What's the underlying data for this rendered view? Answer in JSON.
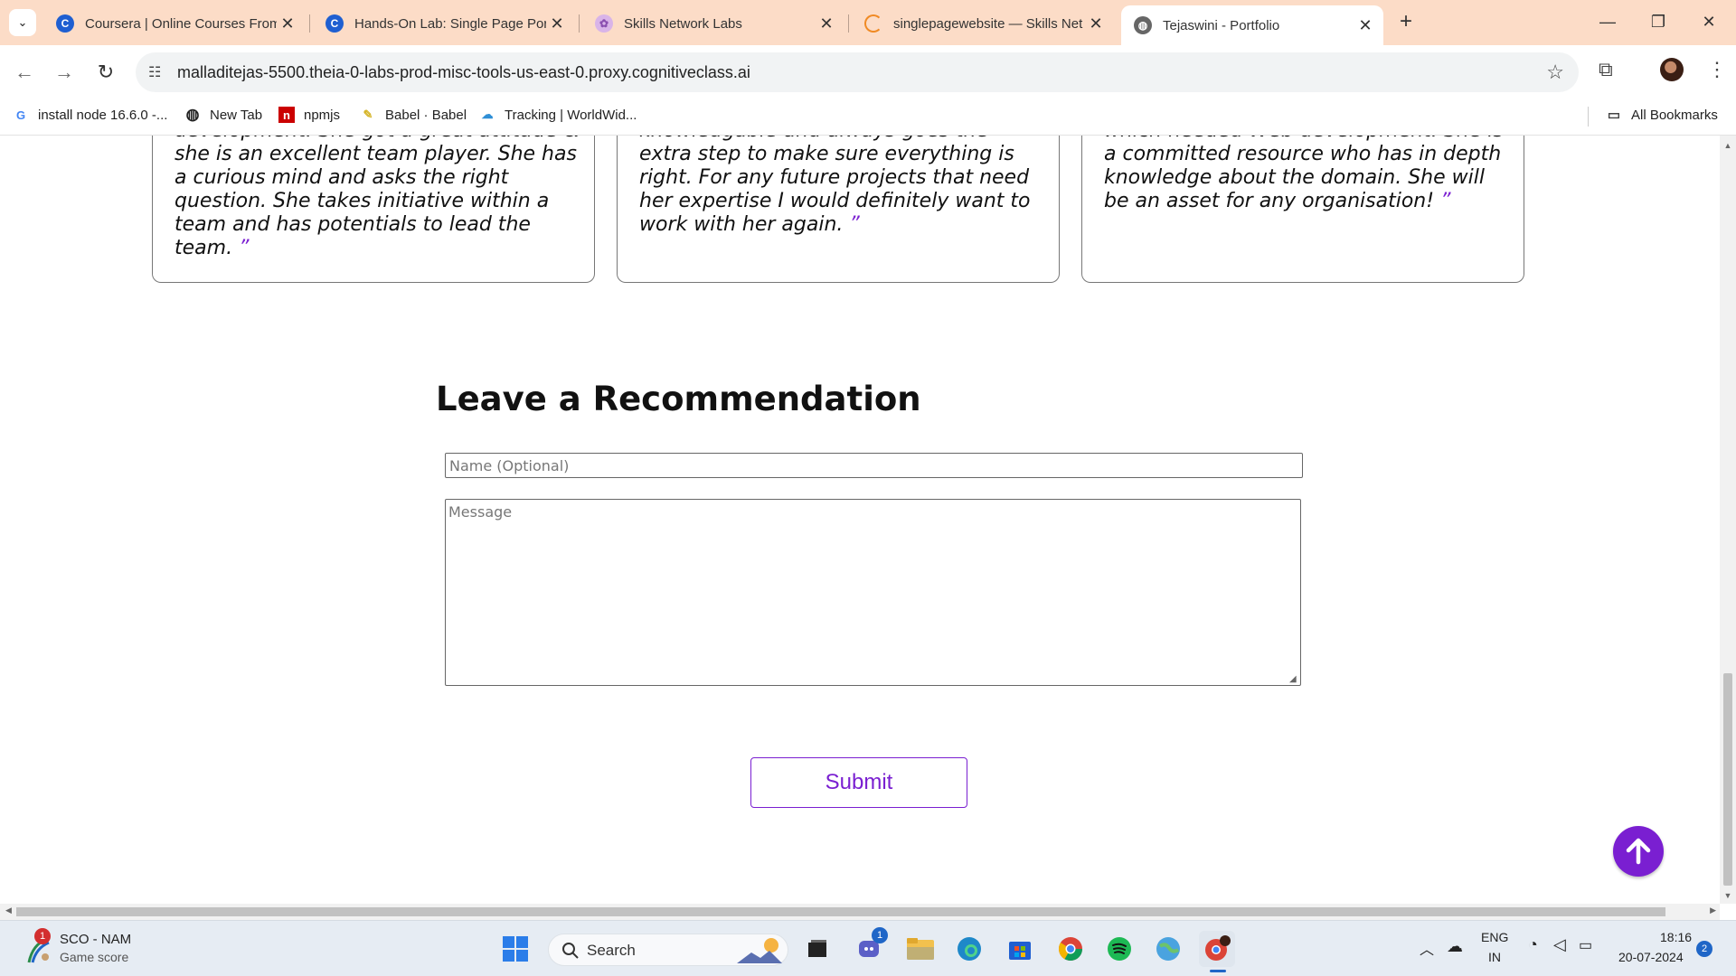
{
  "browser": {
    "tabs": [
      {
        "title": "Coursera | Online Courses From",
        "favicon": "coursera-icon",
        "active": false
      },
      {
        "title": "Hands-On Lab: Single Page Por",
        "favicon": "coursera-icon",
        "active": false
      },
      {
        "title": "Skills Network Labs",
        "favicon": "skills-network-icon",
        "active": false
      },
      {
        "title": "singlepagewebsite — Skills Net",
        "favicon": "loading-icon",
        "active": false
      },
      {
        "title": "Tejaswini - Portfolio",
        "favicon": "globe-icon",
        "active": true
      }
    ],
    "url": "malladitejas-5500.theia-0-labs-prod-misc-tools-us-east-0.proxy.cognitiveclass.ai",
    "bookmarks": [
      {
        "label": "install node 16.6.0 -...",
        "icon": "google-icon"
      },
      {
        "label": "New Tab",
        "icon": "globe-icon"
      },
      {
        "label": "npmjs",
        "icon": "npm-icon"
      },
      {
        "label": "Babel · Babel",
        "icon": "babel-icon"
      },
      {
        "label": "Tracking | WorldWid...",
        "icon": "tracking-icon"
      }
    ],
    "all_bookmarks_label": "All Bookmarks"
  },
  "page": {
    "testimonials": [
      {
        "text": "development. She got a great attitude & she is an excellent team player. She has a curious mind and asks the right question. She takes initiative within a team and has potentials to lead the team."
      },
      {
        "text": "knowledgable and always goes the extra step to make sure everything is right. For any future projects that need her expertise I would definitely want to work with her again."
      },
      {
        "text": "which needed Web development. She is a committed resource who has in depth knowledge about the domain. She will be an asset for any organisation!"
      }
    ],
    "close_quote": "”",
    "recommendation_title": "Leave a Recommendation",
    "name_placeholder": "Name (Optional)",
    "message_placeholder": "Message",
    "submit_label": "Submit",
    "accent_color": "#7a1fd1"
  },
  "taskbar": {
    "widget_title": "SCO - NAM",
    "widget_subtitle": "Game score",
    "widget_badge": "1",
    "search_label": "Search",
    "teams_badge": "1",
    "language_top": "ENG",
    "language_bottom": "IN",
    "time": "18:16",
    "date": "20-07-2024",
    "notification_count": "2"
  }
}
